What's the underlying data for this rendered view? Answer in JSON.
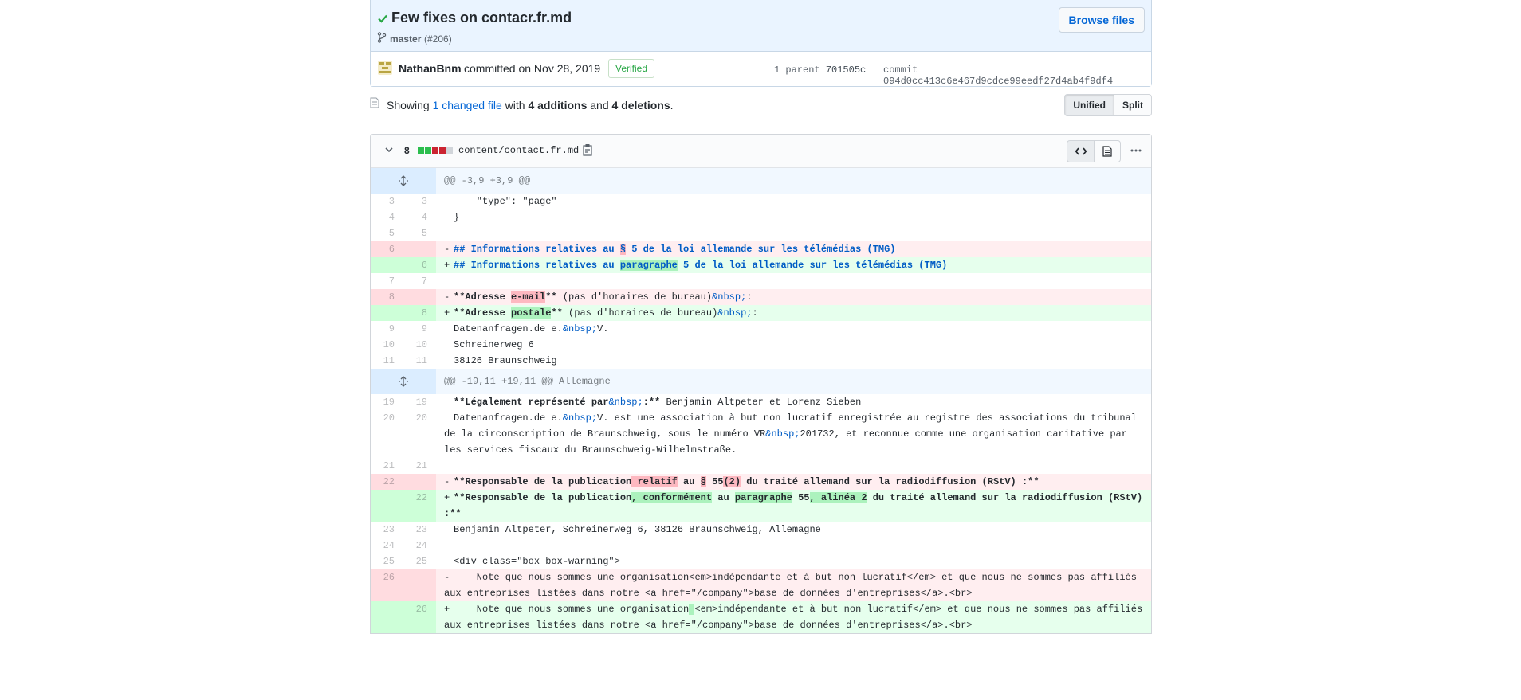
{
  "commit": {
    "title": "Few fixes on contacr.fr.md",
    "branch": "master",
    "pr_ref": "(#206)",
    "browse_label": "Browse files",
    "author": "NathanBnm",
    "committed_text": "committed on Nov 28, 2019",
    "verified_label": "Verified",
    "parent_label": "1 parent",
    "parent_sha": "701505c",
    "commit_label": "commit",
    "commit_sha": "094d0cc413c6e467d9cdce99eedf27d4ab4f9df4"
  },
  "toc": {
    "showing": "Showing",
    "changed_files": "1 changed file",
    "with": "with",
    "additions": "4 additions",
    "and": "and",
    "deletions": "4 deletions",
    "period": ".",
    "unified_label": "Unified",
    "split_label": "Split"
  },
  "file": {
    "changes": "8",
    "path": "content/contact.fr.md",
    "diffstat_colors": [
      "#2cbe4e",
      "#2cbe4e",
      "#cb2431",
      "#cb2431",
      "#d1d5da"
    ]
  },
  "colors": {
    "added_bg": "#e6ffed",
    "deleted_bg": "#ffeef0",
    "hunk_bg": "#f1f8ff",
    "link": "#0366d6"
  },
  "diff_lines": [
    {
      "type": "hunk",
      "text": "@@ -3,9 +3,9 @@"
    },
    {
      "type": "ctx",
      "old": "3",
      "new": "3",
      "parts": [
        {
          "t": "    \"type\": \"page\""
        }
      ]
    },
    {
      "type": "ctx",
      "old": "4",
      "new": "4",
      "parts": [
        {
          "t": "}"
        }
      ]
    },
    {
      "type": "ctx",
      "old": "5",
      "new": "5",
      "parts": [
        {
          "t": ""
        }
      ]
    },
    {
      "type": "del",
      "old": "6",
      "new": "",
      "parts": [
        {
          "t": "## Informations relatives au ",
          "c": "md-head"
        },
        {
          "t": "§",
          "c": "md-head hl-del"
        },
        {
          "t": " 5 de la loi allemande sur les télémédias (TMG)",
          "c": "md-head"
        }
      ]
    },
    {
      "type": "add",
      "old": "",
      "new": "6",
      "parts": [
        {
          "t": "## Informations relatives au ",
          "c": "md-head"
        },
        {
          "t": "paragraphe",
          "c": "md-head hl-add"
        },
        {
          "t": " 5 de la loi allemande sur les télémédias (TMG)",
          "c": "md-head"
        }
      ]
    },
    {
      "type": "ctx",
      "old": "7",
      "new": "7",
      "parts": [
        {
          "t": ""
        }
      ]
    },
    {
      "type": "del",
      "old": "8",
      "new": "",
      "parts": [
        {
          "t": "**Adresse ",
          "c": "md-bold"
        },
        {
          "t": "e-mail",
          "c": "md-bold hl-del"
        },
        {
          "t": "**",
          "c": "md-bold"
        },
        {
          "t": " (pas d'horaires de bureau)"
        },
        {
          "t": "&nbsp;",
          "c": "ent"
        },
        {
          "t": ":"
        }
      ]
    },
    {
      "type": "add",
      "old": "",
      "new": "8",
      "parts": [
        {
          "t": "**Adresse ",
          "c": "md-bold"
        },
        {
          "t": "postale",
          "c": "md-bold hl-add"
        },
        {
          "t": "**",
          "c": "md-bold"
        },
        {
          "t": " (pas d'horaires de bureau)"
        },
        {
          "t": "&nbsp;",
          "c": "ent"
        },
        {
          "t": ":"
        }
      ]
    },
    {
      "type": "ctx",
      "old": "9",
      "new": "9",
      "parts": [
        {
          "t": "Datenanfragen.de e."
        },
        {
          "t": "&nbsp;",
          "c": "ent"
        },
        {
          "t": "V."
        }
      ]
    },
    {
      "type": "ctx",
      "old": "10",
      "new": "10",
      "parts": [
        {
          "t": "Schreinerweg 6"
        }
      ]
    },
    {
      "type": "ctx",
      "old": "11",
      "new": "11",
      "parts": [
        {
          "t": "38126 Braunschweig"
        }
      ]
    },
    {
      "type": "hunk",
      "text": "@@ -19,11 +19,11 @@ Allemagne"
    },
    {
      "type": "ctx",
      "old": "19",
      "new": "19",
      "parts": [
        {
          "t": "**Légalement représenté par",
          "c": "md-bold"
        },
        {
          "t": "&nbsp;",
          "c": "ent"
        },
        {
          "t": ":**",
          "c": "md-bold"
        },
        {
          "t": " Benjamin Altpeter et Lorenz Sieben"
        }
      ]
    },
    {
      "type": "ctx",
      "old": "20",
      "new": "20",
      "parts": [
        {
          "t": "Datenanfragen.de e."
        },
        {
          "t": "&nbsp;",
          "c": "ent"
        },
        {
          "t": "V. est une association à but non lucratif enregistrée au registre des associations du tribunal de la circonscription de Braunschweig, sous le numéro VR"
        },
        {
          "t": "&nbsp;",
          "c": "ent"
        },
        {
          "t": "201732, et reconnue comme une organisation caritative par les services fiscaux du Braunschweig-Wilhelmstraße."
        }
      ]
    },
    {
      "type": "ctx",
      "old": "21",
      "new": "21",
      "parts": [
        {
          "t": ""
        }
      ]
    },
    {
      "type": "del",
      "old": "22",
      "new": "",
      "parts": [
        {
          "t": "**Responsable de la publication",
          "c": "md-bold"
        },
        {
          "t": " relatif",
          "c": "md-bold hl-del"
        },
        {
          "t": " au ",
          "c": "md-bold"
        },
        {
          "t": "§",
          "c": "md-bold hl-del"
        },
        {
          "t": " 55",
          "c": "md-bold"
        },
        {
          "t": "(2)",
          "c": "md-bold hl-del"
        },
        {
          "t": " du traité allemand sur la radiodiffusion (RStV) :**",
          "c": "md-bold"
        }
      ]
    },
    {
      "type": "add",
      "old": "",
      "new": "22",
      "parts": [
        {
          "t": "**Responsable de la publication",
          "c": "md-bold"
        },
        {
          "t": ", conformément",
          "c": "md-bold hl-add"
        },
        {
          "t": " au ",
          "c": "md-bold"
        },
        {
          "t": "paragraphe",
          "c": "md-bold hl-add"
        },
        {
          "t": " 55",
          "c": "md-bold"
        },
        {
          "t": ", alinéa 2",
          "c": "md-bold hl-add"
        },
        {
          "t": " du traité allemand sur la radiodiffusion (RStV) :**",
          "c": "md-bold"
        }
      ]
    },
    {
      "type": "ctx",
      "old": "23",
      "new": "23",
      "parts": [
        {
          "t": "Benjamin Altpeter, Schreinerweg 6, 38126 Braunschweig, Allemagne"
        }
      ]
    },
    {
      "type": "ctx",
      "old": "24",
      "new": "24",
      "parts": [
        {
          "t": ""
        }
      ]
    },
    {
      "type": "ctx",
      "old": "25",
      "new": "25",
      "parts": [
        {
          "t": "<div class=\"box box-warning\">"
        }
      ]
    },
    {
      "type": "del",
      "old": "26",
      "new": "",
      "parts": [
        {
          "t": "    Note que nous sommes une organisation<em>indépendante et à but non lucratif</em> et que nous ne sommes pas affiliés aux entreprises listées dans notre <a href=\"/company\">base de données d'entreprises</a>.<br>"
        }
      ]
    },
    {
      "type": "add",
      "old": "",
      "new": "26",
      "parts": [
        {
          "t": "    Note que nous sommes une organisation"
        },
        {
          "t": " ",
          "c": "hl-add"
        },
        {
          "t": "<em>indépendante et à but non lucratif</em> et que nous ne sommes pas affiliés aux entreprises listées dans notre <a href=\"/company\">base de données d'entreprises</a>.<br>"
        }
      ]
    }
  ]
}
